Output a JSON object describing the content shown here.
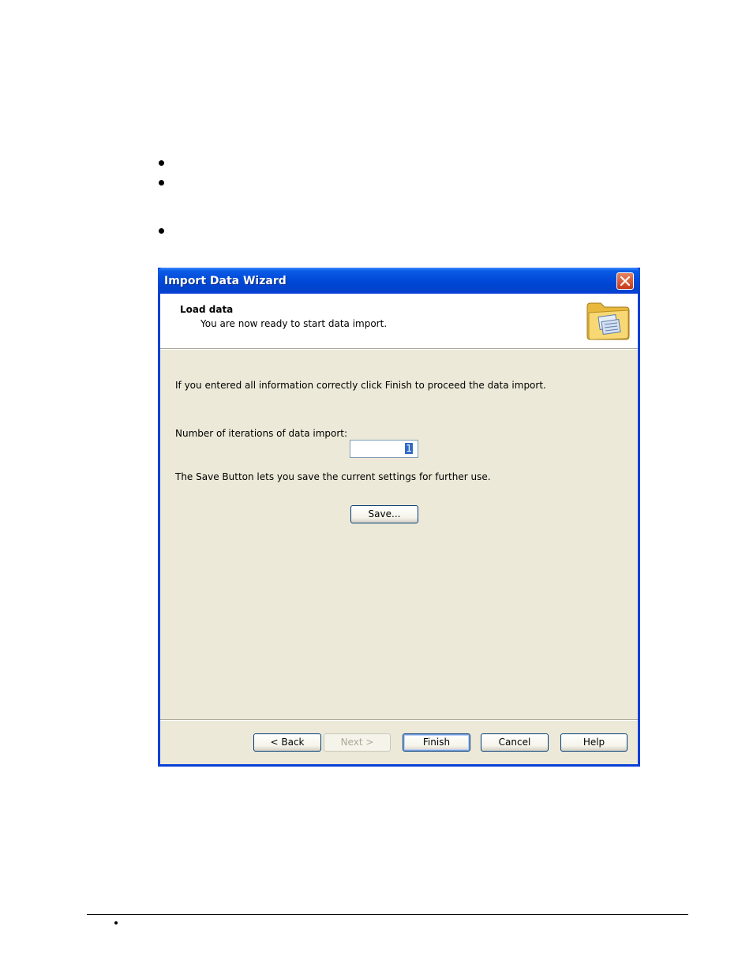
{
  "window": {
    "title": "Import Data Wizard"
  },
  "header": {
    "title": "Load data",
    "subtitle": "You are now ready to start data import.",
    "icon": "folder-icon"
  },
  "body": {
    "instruction": "If you entered all information correctly click Finish to proceed the data import.",
    "iterations_label": "Number of iterations of data import:",
    "iterations_value": "1",
    "save_info": "The Save Button lets you save the current settings for further use.",
    "save_button": "Save..."
  },
  "footer": {
    "back": "< Back",
    "next": "Next >",
    "finish": "Finish",
    "cancel": "Cancel",
    "help": "Help"
  },
  "colors": {
    "titlebar": "#0047D6",
    "dialog_bg": "#ECE9D8",
    "selection": "#316AC5"
  }
}
